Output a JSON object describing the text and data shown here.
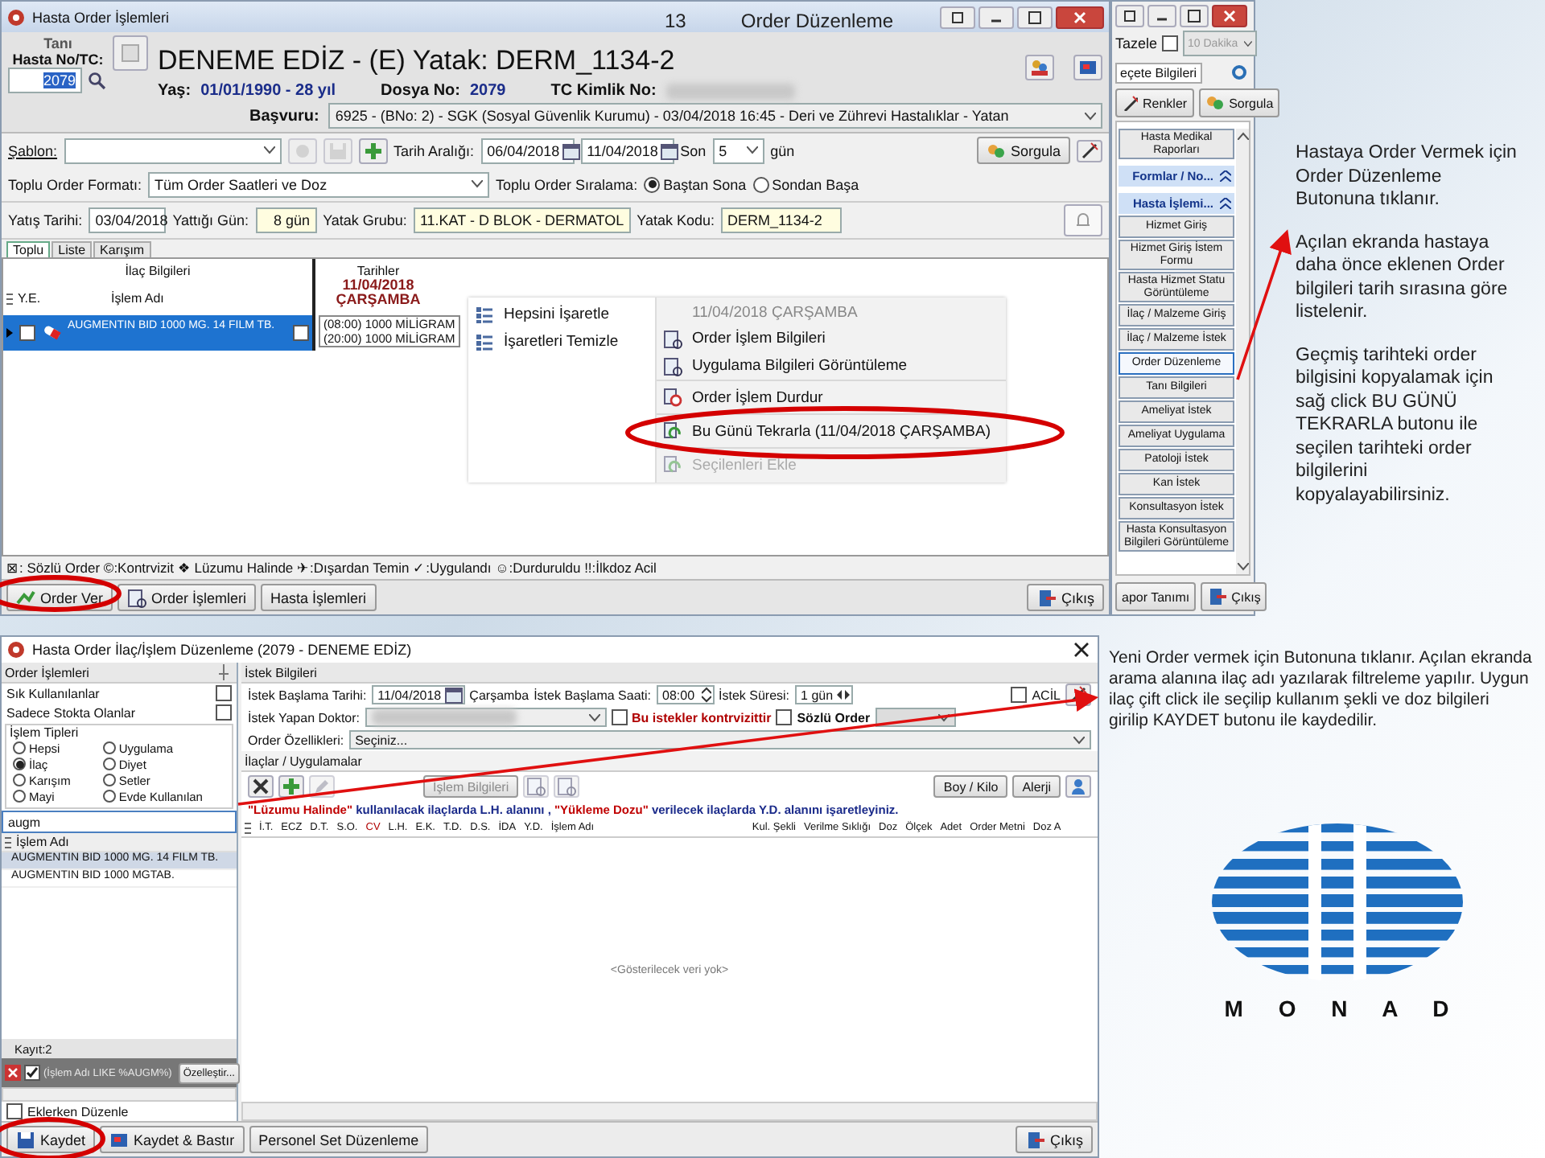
{
  "slide": {
    "number": "13",
    "title": "Order Düzenleme"
  },
  "order_window": {
    "title": "Hasta Order İşlemleri",
    "patient": {
      "diagnosis_label": "Tanı",
      "id_label": "Hasta No/TC:",
      "id_value": "2079",
      "heading": "DENEME EDİZ - (E) Yatak: DERM_1134-2",
      "age_label": "Yaş:",
      "age_value": "01/01/1990 - 28 yıl",
      "file_label": "Dosya No:",
      "file_value": "2079",
      "tc_label": "TC Kimlik No:",
      "application_label": "Başvuru:",
      "application_value": "6925 - (BNo: 2) - SGK (Sosyal Güvenlik Kurumu) - 03/04/2018 16:45 - Deri ve Zührevi Hastalıklar  - Yatan"
    },
    "filters": {
      "template_label": "Şablon:",
      "date_range_label": "Tarih Aralığı:",
      "date_from": "06/04/2018",
      "date_to": "11/04/2018",
      "last_label": "Son",
      "last_value": "5",
      "days_label": "gün",
      "query_button": "Sorgula",
      "format_label": "Toplu Order Formatı:",
      "format_value": "Tüm Order Saatleri ve Doz",
      "sort_label": "Toplu Order Sıralama:",
      "sort_options": [
        {
          "label": "Baştan Sona",
          "selected": true
        },
        {
          "label": "Sondan Başa",
          "selected": false
        }
      ]
    },
    "stay": {
      "admit_label": "Yatış Tarihi:",
      "admit_value": "03/04/2018",
      "days_label": "Yattığı Gün:",
      "days_value": "8 gün",
      "group_label": "Yatak Grubu:",
      "group_value": "11.KAT - D BLOK - DERMATOL",
      "code_label": "Yatak Kodu:",
      "code_value": "DERM_1134-2"
    },
    "tabs": [
      {
        "label": "Toplu",
        "selected": true
      },
      {
        "label": "Liste",
        "selected": false
      },
      {
        "label": "Karışım",
        "selected": false
      }
    ],
    "grid": {
      "group_drug": "İlaç Bilgileri",
      "group_dates": "Tarihler",
      "col_ye": "Y.E.",
      "col_name": "İşlem Adı",
      "date_heading": "11/04/2018",
      "day_heading": "ÇARŞAMBA",
      "rows": [
        {
          "name": "AUGMENTIN BID 1000 MG. 14 FILM TB.",
          "selected": true,
          "checked": false,
          "date_checked": false,
          "doses": [
            "(08:00) 1000 MİLİGRAM",
            "(20:00) 1000 MİLİGRAM"
          ]
        }
      ]
    },
    "context_menu": {
      "left_items": [
        {
          "label": "Hepsini İşaretle"
        },
        {
          "label": "İşaretleri Temizle"
        }
      ],
      "right_items": [
        {
          "kind": "header",
          "label": "11/04/2018 ÇARŞAMBA"
        },
        {
          "kind": "item",
          "label": "Order İşlem Bilgileri",
          "disabled": false,
          "group_start": false
        },
        {
          "kind": "item",
          "label": "Uygulama Bilgileri Görüntüleme",
          "disabled": false,
          "group_start": false
        },
        {
          "kind": "item",
          "label": "Order İşlem Durdur",
          "disabled": false,
          "group_start": true
        },
        {
          "kind": "item",
          "label": "Bu Günü Tekrarla (11/04/2018 ÇARŞAMBA)",
          "disabled": false,
          "group_start": true
        },
        {
          "kind": "item",
          "label": "Seçilenleri Ekle",
          "disabled": true,
          "group_start": true
        }
      ]
    },
    "legend": "⊠: Sözlü Order ©:Kontrvizit ❖ Lüzumu Halinde ✈:Dışardan Temin ✓:Uygulandı ☺:Durduruldu !!:İlkdoz Acil",
    "buttons": [
      "Order Ver",
      "Order İşlemleri",
      "Hasta İşlemleri"
    ],
    "exit_button": "Çıkış"
  },
  "side_panel": {
    "refresh_label": "Tazele",
    "refresh_checked": false,
    "interval": "10 Dakika",
    "tab_label": "eçete Bilgileri",
    "colors_button": "Renkler",
    "query_button": "Sorgula",
    "items": [
      {
        "kind": "button",
        "label": "Hasta Medikal Raporları",
        "selected": false
      },
      {
        "kind": "group",
        "label": "Formlar / No..."
      },
      {
        "kind": "group",
        "label": "Hasta İşlemi..."
      },
      {
        "kind": "button",
        "label": "Hizmet Giriş",
        "selected": false
      },
      {
        "kind": "button",
        "label": "Hizmet Giriş İstem Formu",
        "selected": false
      },
      {
        "kind": "button",
        "label": "Hasta Hizmet Statu Görüntüleme",
        "selected": false
      },
      {
        "kind": "button",
        "label": "İlaç / Malzeme Giriş",
        "selected": false
      },
      {
        "kind": "button",
        "label": "İlaç / Malzeme İstek",
        "selected": false
      },
      {
        "kind": "button",
        "label": "Order Düzenleme",
        "selected": true
      },
      {
        "kind": "button",
        "label": "Tanı Bilgileri",
        "selected": false
      },
      {
        "kind": "button",
        "label": "Ameliyat İstek",
        "selected": false
      },
      {
        "kind": "button",
        "label": "Ameliyat Uygulama",
        "selected": false
      },
      {
        "kind": "button",
        "label": "Patoloji İstek",
        "selected": false
      },
      {
        "kind": "button",
        "label": "Kan İstek",
        "selected": false
      },
      {
        "kind": "button",
        "label": "Konsultasyon İstek",
        "selected": false
      },
      {
        "kind": "button",
        "label": "Hasta Konsultasyon Bilgileri Görüntüleme",
        "selected": false
      }
    ],
    "report_button": "apor Tanımı",
    "exit_button": "Çıkış"
  },
  "notes": [
    "Hastaya Order Vermek için Order Düzenleme Butonuna tıklanır.",
    "Açılan ekranda hastaya daha önce eklenen Order bilgileri tarih sırasına göre listelenir.",
    "Geçmiş tarihteki order bilgisini kopyalamak için sağ click BU GÜNÜ TEKRARLA butonu ile seçilen tarihteki order bilgilerini kopyalayabilirsiniz."
  ],
  "edit_window": {
    "title": "Hasta Order İlaç/İşlem Düzenleme (2079 - DENEME EDİZ)",
    "left": {
      "header": "Order İşlemleri",
      "options": [
        {
          "label": "Sık Kullanılanlar",
          "checked": false
        },
        {
          "label": "Sadece Stokta Olanlar",
          "checked": false
        }
      ],
      "types_label": "İşlem Tipleri",
      "types": [
        {
          "label": "Hepsi",
          "selected": false
        },
        {
          "label": "İlaç",
          "selected": true
        },
        {
          "label": "Karışım",
          "selected": false
        },
        {
          "label": "Mayi",
          "selected": false
        },
        {
          "label": "Uygulama",
          "selected": false
        },
        {
          "label": "Diyet",
          "selected": false
        },
        {
          "label": "Setler",
          "selected": false
        },
        {
          "label": "Evde Kullanılan",
          "selected": false
        }
      ],
      "search_value": "augm",
      "list_header": "İşlem Adı",
      "items": [
        {
          "label": "AUGMENTIN BID 1000 MG. 14 FILM TB.",
          "selected": true
        },
        {
          "label": "AUGMENTIN BID 1000 MGTAB.",
          "selected": false
        }
      ],
      "count": "Kayıt:2",
      "filter_checked": true,
      "filter_text": "(İşlem Adı LIKE %AUGM%)",
      "customize_button": "Özelleştir...",
      "edit_on_add": {
        "label": "Eklerken Düzenle",
        "checked": false
      }
    },
    "request": {
      "header": "İstek Bilgileri",
      "start_date_label": "İstek Başlama Tarihi:",
      "start_date": "11/04/2018",
      "weekday": "Çarşamba",
      "start_time_label": "İstek Başlama Saati:",
      "start_time": "08:00",
      "duration_label": "İstek Süresi:",
      "duration": "1 gün",
      "urgent": {
        "label": "ACİL",
        "checked": false
      },
      "doctor_label": "İstek Yapan Doktor:",
      "countervisit": {
        "label": "Bu istekler kontrvizittir",
        "checked": false
      },
      "verbal": {
        "label": "Sözlü Order",
        "checked": false
      },
      "properties_label": "Order Özellikleri:",
      "properties_value": "Seçiniz..."
    },
    "drugs": {
      "header": "İlaçlar / Uygulamalar",
      "info_button": "İşlem Bilgileri",
      "info_disabled": true,
      "height_weight_button": "Boy / Kilo",
      "allergy_button": "Alerji",
      "notice": [
        {
          "text": "\"Lüzumu Halinde\"",
          "kind": "highlight"
        },
        {
          "text": " kullanılacak ilaçlarda L.H. alanını , ",
          "kind": "plain"
        },
        {
          "text": "\"Yükleme Dozu\"",
          "kind": "highlight"
        },
        {
          "text": " verilecek ilaçlarda Y.D. alanını işaretleyiniz.",
          "kind": "plain"
        }
      ],
      "columns": [
        {
          "label": "İ.T."
        },
        {
          "label": "ECZ"
        },
        {
          "label": "D.T."
        },
        {
          "label": "S.O."
        },
        {
          "label": "CV",
          "color": "#b00000"
        },
        {
          "label": "L.H."
        },
        {
          "label": "E.K."
        },
        {
          "label": "T.D."
        },
        {
          "label": "D.S."
        },
        {
          "label": "İDA"
        },
        {
          "label": "Y.D."
        },
        {
          "label": "İşlem Adı",
          "wide": true
        },
        {
          "label": "Kul. Şekli"
        },
        {
          "label": "Verilme Sıklığı"
        },
        {
          "label": "Doz"
        },
        {
          "label": "Ölçek"
        },
        {
          "label": "Adet"
        },
        {
          "label": "Order Metni"
        },
        {
          "label": "Doz A"
        }
      ],
      "empty_text": "<Gösterilecek veri yok>"
    },
    "buttons": [
      "Kaydet",
      "Kaydet & Bastır",
      "Personel Set Düzenleme"
    ],
    "exit_button": "Çıkış"
  },
  "bottom_note": "Yeni Order vermek için Butonuna tıklanır. Açılan ekranda arama alanına ilaç adı yazılarak filtreleme yapılır. Uygun ilaç çift click ile seçilip kullanım şekli ve doz bilgileri girilip KAYDET butonu ile kaydedilir.",
  "logo": {
    "letters": "M O N A D"
  }
}
